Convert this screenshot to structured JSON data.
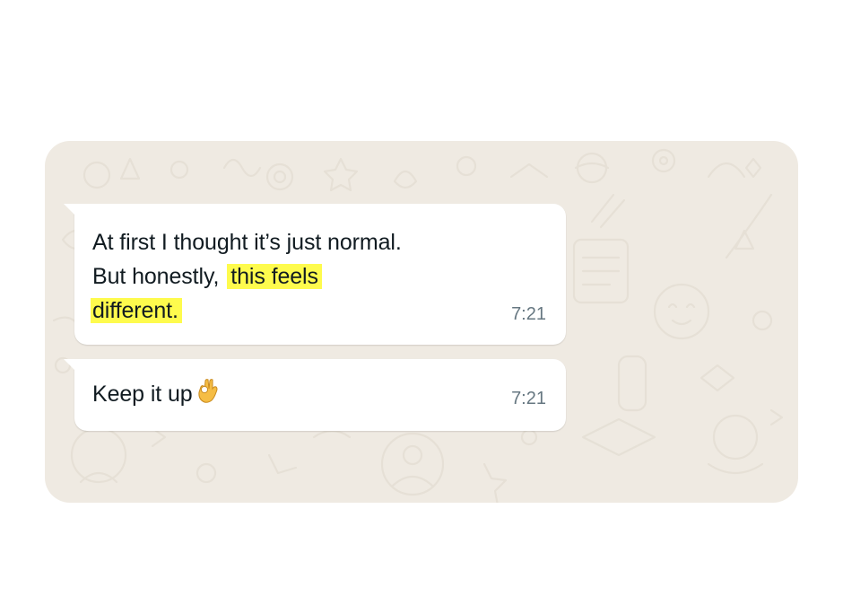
{
  "messages": [
    {
      "line1": "At first I thought it’s just normal.",
      "line2_plain": "But honestly,",
      "line2_highlight": "this feels",
      "line3_highlight": "different.",
      "time": "7:21"
    },
    {
      "text": "Keep it up",
      "emoji": "ok-hand-icon",
      "time": "7:21"
    }
  ],
  "colors": {
    "chat_background": "#efeae2",
    "bubble": "#ffffff",
    "highlight": "#fefb4d",
    "text": "#111b21",
    "timestamp": "#667781"
  }
}
